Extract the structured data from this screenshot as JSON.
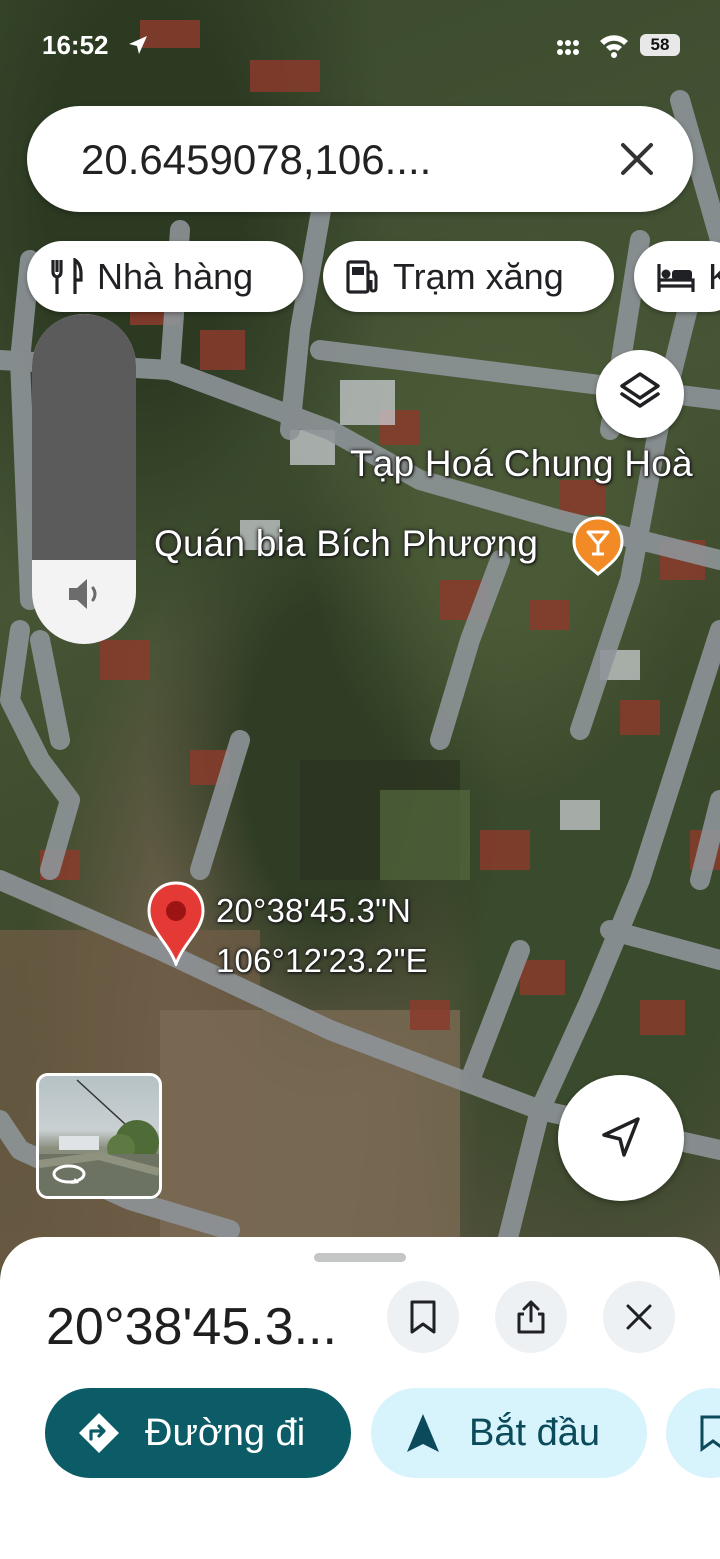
{
  "status_bar": {
    "time": "16:52",
    "battery": "58"
  },
  "search": {
    "query": "20.6459078,106...."
  },
  "chips": [
    {
      "label": "Nhà hàng",
      "icon": "restaurant-icon"
    },
    {
      "label": "Trạm xăng",
      "icon": "gas-station-icon"
    },
    {
      "label": "K",
      "icon": "hotel-icon"
    }
  ],
  "map": {
    "labels": {
      "shop": "Tạp Hoá Chung Hoà",
      "bar": "Quán bia Bích Phương"
    },
    "pin": {
      "lat": "20°38'45.3\"N",
      "lng": "106°12'23.2\"E"
    },
    "accent_colors": {
      "pin": "#e53935",
      "poi": "#f28b25"
    }
  },
  "sheet": {
    "title": "20°38'45.3...",
    "directions_label": "Đường đi",
    "start_label": "Bắt đầu"
  }
}
